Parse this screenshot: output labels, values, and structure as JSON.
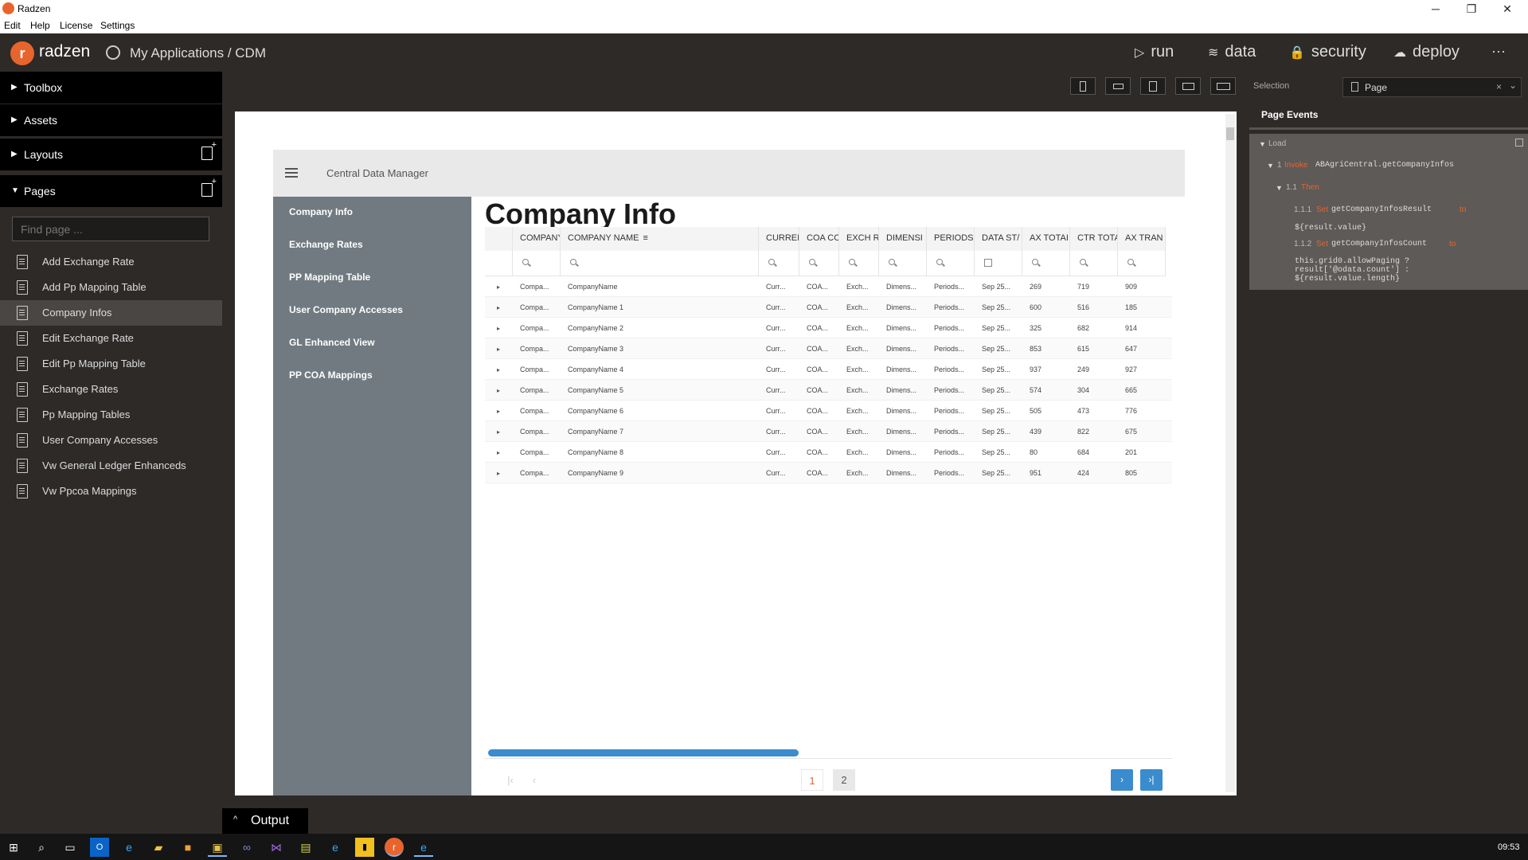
{
  "window": {
    "title": "Radzen",
    "menu": [
      "Edit",
      "Help",
      "License",
      "Settings"
    ],
    "controls": [
      "─",
      "❐",
      "✕"
    ]
  },
  "header": {
    "brand": "radzen",
    "brand_mark": "r",
    "breadcrumb": "My Applications / CDM",
    "nav": [
      {
        "icon": "run-icon",
        "glyph": "▷",
        "label": "run"
      },
      {
        "icon": "data-icon",
        "glyph": "≋",
        "label": "data"
      },
      {
        "icon": "lock-icon",
        "glyph": "🔒",
        "label": "security"
      },
      {
        "icon": "cloud-upload-icon",
        "glyph": "☁",
        "label": "deploy"
      }
    ],
    "more": "···"
  },
  "sidebar": {
    "sections": [
      {
        "label": "Toolbox",
        "expanded": false
      },
      {
        "label": "Assets",
        "expanded": false
      },
      {
        "label": "Layouts",
        "expanded": false
      },
      {
        "label": "Pages",
        "expanded": true
      }
    ],
    "find_placeholder": "Find page ...",
    "pages": [
      "Add Exchange Rate",
      "Add Pp Mapping Table",
      "Company Infos",
      "Edit Exchange Rate",
      "Edit Pp Mapping Table",
      "Exchange Rates",
      "Pp Mapping Tables",
      "User Company Accesses",
      "Vw General Ledger Enhanceds",
      "Vw Ppcoa Mappings"
    ],
    "active_page": "Company Infos"
  },
  "canvas": {
    "app_title": "Central Data Manager",
    "nav": [
      "Company Info",
      "Exchange Rates",
      "PP Mapping Table",
      "User Company Accesses",
      "GL Enhanced View",
      "PP COA Mappings"
    ],
    "heading": "Company Info",
    "grid": {
      "columns": [
        "COMPANY",
        "COMPANY NAME",
        "CURREI",
        "COA CC",
        "EXCH R",
        "DIMENSI",
        "PERIODS",
        "DATA ST/",
        "AX TOTAI",
        "CTR TOTA",
        "AX TRAN"
      ],
      "sort_indicator": "≡",
      "rows": [
        [
          "Compa...",
          "CompanyName",
          "Curr...",
          "COA...",
          "Exch...",
          "Dimens...",
          "Periods...",
          "Sep 25...",
          "269",
          "719",
          "909"
        ],
        [
          "Compa...",
          "CompanyName 1",
          "Curr...",
          "COA...",
          "Exch...",
          "Dimens...",
          "Periods...",
          "Sep 25...",
          "600",
          "516",
          "185"
        ],
        [
          "Compa...",
          "CompanyName 2",
          "Curr...",
          "COA...",
          "Exch...",
          "Dimens...",
          "Periods...",
          "Sep 25...",
          "325",
          "682",
          "914"
        ],
        [
          "Compa...",
          "CompanyName 3",
          "Curr...",
          "COA...",
          "Exch...",
          "Dimens...",
          "Periods...",
          "Sep 25...",
          "853",
          "615",
          "647"
        ],
        [
          "Compa...",
          "CompanyName 4",
          "Curr...",
          "COA...",
          "Exch...",
          "Dimens...",
          "Periods...",
          "Sep 25...",
          "937",
          "249",
          "927"
        ],
        [
          "Compa...",
          "CompanyName 5",
          "Curr...",
          "COA...",
          "Exch...",
          "Dimens...",
          "Periods...",
          "Sep 25...",
          "574",
          "304",
          "665"
        ],
        [
          "Compa...",
          "CompanyName 6",
          "Curr...",
          "COA...",
          "Exch...",
          "Dimens...",
          "Periods...",
          "Sep 25...",
          "505",
          "473",
          "776"
        ],
        [
          "Compa...",
          "CompanyName 7",
          "Curr...",
          "COA...",
          "Exch...",
          "Dimens...",
          "Periods...",
          "Sep 25...",
          "439",
          "822",
          "675"
        ],
        [
          "Compa...",
          "CompanyName 8",
          "Curr...",
          "COA...",
          "Exch...",
          "Dimens...",
          "Periods...",
          "Sep 25...",
          "80",
          "684",
          "201"
        ],
        [
          "Compa...",
          "CompanyName 9",
          "Curr...",
          "COA...",
          "Exch...",
          "Dimens...",
          "Periods...",
          "Sep 25...",
          "951",
          "424",
          "805"
        ]
      ],
      "pager": {
        "pages": [
          "1",
          "2"
        ],
        "current": "1",
        "first": "|‹",
        "prev": "‹",
        "next": "›",
        "last": "›|"
      }
    }
  },
  "right_panel": {
    "selection_label": "Selection",
    "selected": "Page",
    "clear": "×",
    "dropdown": "⌄",
    "events_title": "Page Events",
    "event_name": "Load",
    "actions": [
      {
        "num": "1",
        "kind": "Invoke",
        "text": "ABAgriCentral.getCompanyInfos"
      },
      {
        "num": "1.1",
        "kind": "Then",
        "text": ""
      },
      {
        "num": "1.1.1",
        "kind": "Set",
        "text": "getCompanyInfosResult",
        "to": "to",
        "value": "${result.value}"
      },
      {
        "num": "1.1.2",
        "kind": "Set",
        "text": "getCompanyInfosCount",
        "to": "to",
        "value": "this.grid0.allowPaging ?",
        "value2": "result['@odata.count'] :",
        "value3": "${result.value.length}"
      }
    ]
  },
  "output": {
    "label": "Output",
    "chevron": "^"
  },
  "taskbar": {
    "time": "09:53"
  },
  "colors": {
    "accent": "#e8642d",
    "grid_accent": "#3a8ccf",
    "chrome": "#2d2a28"
  }
}
